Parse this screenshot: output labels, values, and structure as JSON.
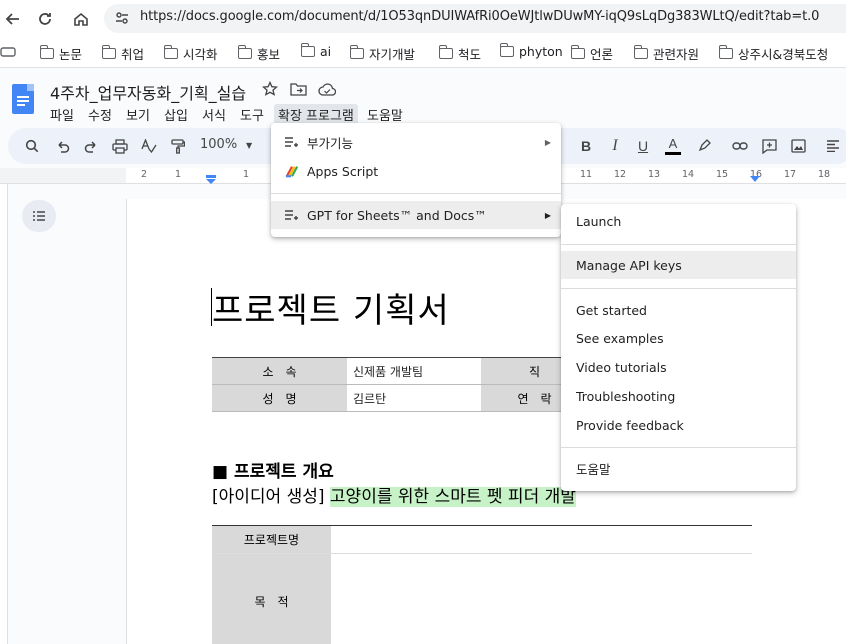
{
  "browser": {
    "url": "https://docs.google.com/document/d/1O53qnDUIWAfRi0OeWJtlwDUwMY-iqQ9sLqDg383WLtQ/edit?tab=t.0"
  },
  "bookmarks": [
    "논문",
    "취업",
    "시각화",
    "홍보",
    "ai",
    "자기개발",
    "척도",
    "phyton",
    "언론",
    "관련자원",
    "상주시&경북도청"
  ],
  "docs": {
    "title": "4주차_업무자동화_기획_실습",
    "menu": [
      "파일",
      "수정",
      "보기",
      "삽입",
      "서식",
      "도구",
      "확장 프로그램",
      "도움말"
    ],
    "zoom": "100%"
  },
  "ruler_numbers": [
    "2",
    "1",
    "1",
    "11",
    "12",
    "13",
    "14",
    "15",
    "16",
    "17",
    "18"
  ],
  "extensions_menu": {
    "items": [
      {
        "label": "부가기능",
        "has_submenu": true
      },
      {
        "label": "Apps Script",
        "has_submenu": false
      },
      {
        "label": "GPT for Sheets™ and Docs™",
        "has_submenu": true
      }
    ]
  },
  "gpt_submenu": {
    "items": [
      "Launch",
      "Manage API keys",
      "Get started",
      "See examples",
      "Video tutorials",
      "Troubleshooting",
      "Provide feedback",
      "도움말"
    ]
  },
  "document": {
    "heading": "프로젝트 기획서",
    "info_table": [
      [
        "소　속",
        "신제품 개발팀",
        "직"
      ],
      [
        "성　명",
        "김르탄",
        "연　락"
      ]
    ],
    "section_title": "■ 프로젝트 개요",
    "section_prefix": "[아이디어 생성] ",
    "section_highlight": "고양이를 위한 스마트 펫 피더 개발",
    "project_table": [
      "프로젝트명",
      "목　적"
    ]
  },
  "colors": {
    "accent": "#4285f4",
    "highlight": "#c7f2c7",
    "header_cell": "#d9d9d9"
  }
}
